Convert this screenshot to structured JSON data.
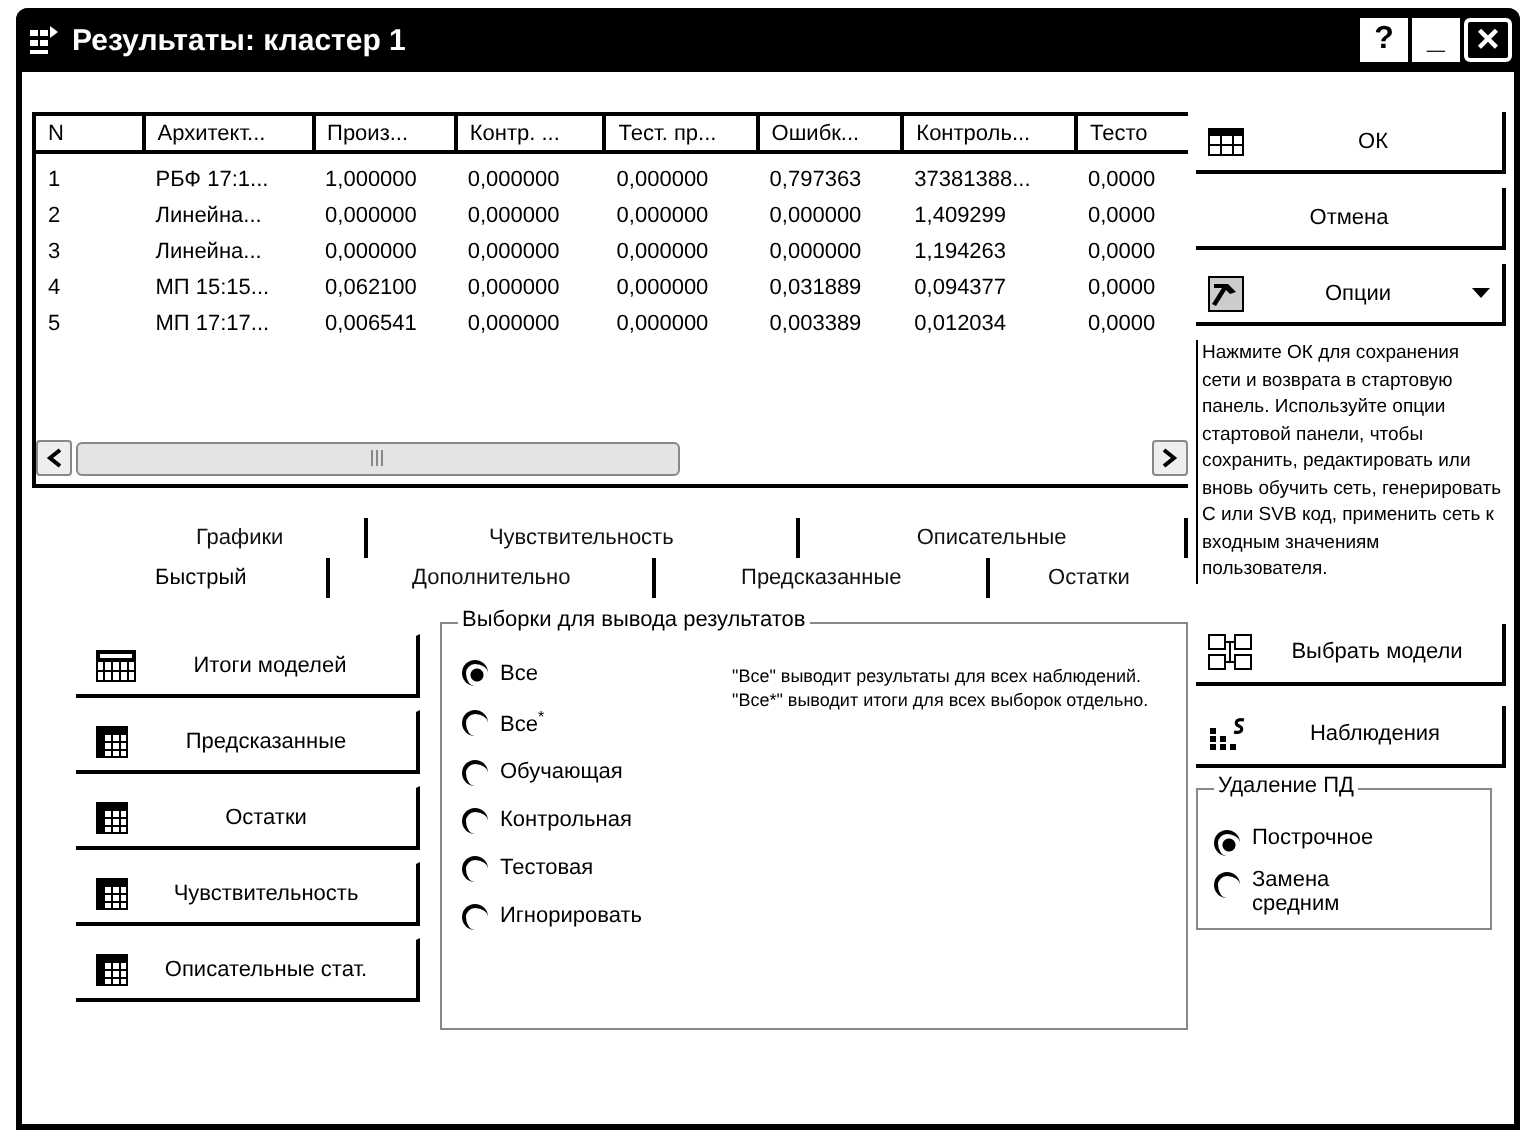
{
  "window": {
    "title": "Результаты: кластер 1",
    "controls": [
      "?",
      "_",
      "×"
    ]
  },
  "table": {
    "columns": [
      "N",
      "Архитект...",
      "Произ...",
      "Контр. ...",
      "Тест. пр...",
      "Ошибк...",
      "Контроль...",
      "Тесто"
    ],
    "rows": [
      [
        "1",
        "РБФ 17:1...",
        "1,000000",
        "0,000000",
        "0,000000",
        "0,797363",
        "37381388...",
        "0,0000"
      ],
      [
        "2",
        "Линейна...",
        "0,000000",
        "0,000000",
        "0,000000",
        "0,000000",
        "1,409299",
        "0,0000"
      ],
      [
        "3",
        "Линейна...",
        "0,000000",
        "0,000000",
        "0,000000",
        "0,000000",
        "1,194263",
        "0,0000"
      ],
      [
        "4",
        "МП 15:15...",
        "0,062100",
        "0,000000",
        "0,000000",
        "0,031889",
        "0,094377",
        "0,0000"
      ],
      [
        "5",
        "МП 17:17...",
        "0,006541",
        "0,000000",
        "0,000000",
        "0,003389",
        "0,012034",
        "0,0000"
      ]
    ]
  },
  "tabs": {
    "back_row": [
      {
        "label": "Графики",
        "selected": false
      },
      {
        "label": "Чувствительность",
        "selected": false
      },
      {
        "label": "Описательные",
        "selected": false
      }
    ],
    "front_row": [
      {
        "label": "Быстрый",
        "selected": true
      },
      {
        "label": "Дополнительно",
        "selected": false
      },
      {
        "label": "Предсказанные",
        "selected": false
      },
      {
        "label": "Остатки",
        "selected": false
      }
    ]
  },
  "result_buttons": [
    {
      "label": "Итоги моделей",
      "kind": "summary"
    },
    {
      "label": "Предсказанные",
      "kind": "grid"
    },
    {
      "label": "Остатки",
      "kind": "grid"
    },
    {
      "label": "Чувствительность",
      "kind": "grid"
    },
    {
      "label": "Описательные стат.",
      "kind": "grid"
    }
  ],
  "samples_group": {
    "title": "Выборки для вывода результатов",
    "options": [
      {
        "label": "Все",
        "selected": true
      },
      {
        "label": "Все$^{*}$",
        "selected": false
      },
      {
        "label": "Обучающая",
        "selected": false
      },
      {
        "label": "Контрольная",
        "selected": false
      },
      {
        "label": "Тестовая",
        "selected": false
      },
      {
        "label": "Игнорировать",
        "selected": false
      }
    ],
    "note": "\"Все\" выводит результаты для всех наблюдений. \"Все*\" выводит итоги для всех выборок отдельно."
  },
  "side_buttons": [
    {
      "label": "ОК",
      "kind": "table"
    },
    {
      "label": "Отмена",
      "kind": "plain"
    },
    {
      "label": "Опции",
      "kind": "menu"
    }
  ],
  "help_text": "Нажмите ОК для сохранения сети и возврата в стартовую панель. Используйте опции стартовой панели, чтобы сохранить, редактировать или вновь обучить сеть, генерировать C или SVB код, применить сеть к входным значениям пользователя.",
  "lower_buttons": [
    {
      "label": "Выбрать модели",
      "kind": "select"
    },
    {
      "label": "Наблюдения",
      "kind": "cases"
    }
  ],
  "missing_group": {
    "title": "Удаление ПД",
    "options": [
      {
        "label": "Построчное",
        "selected": true
      },
      {
        "label": "Замена средним",
        "selected": false
      }
    ]
  }
}
